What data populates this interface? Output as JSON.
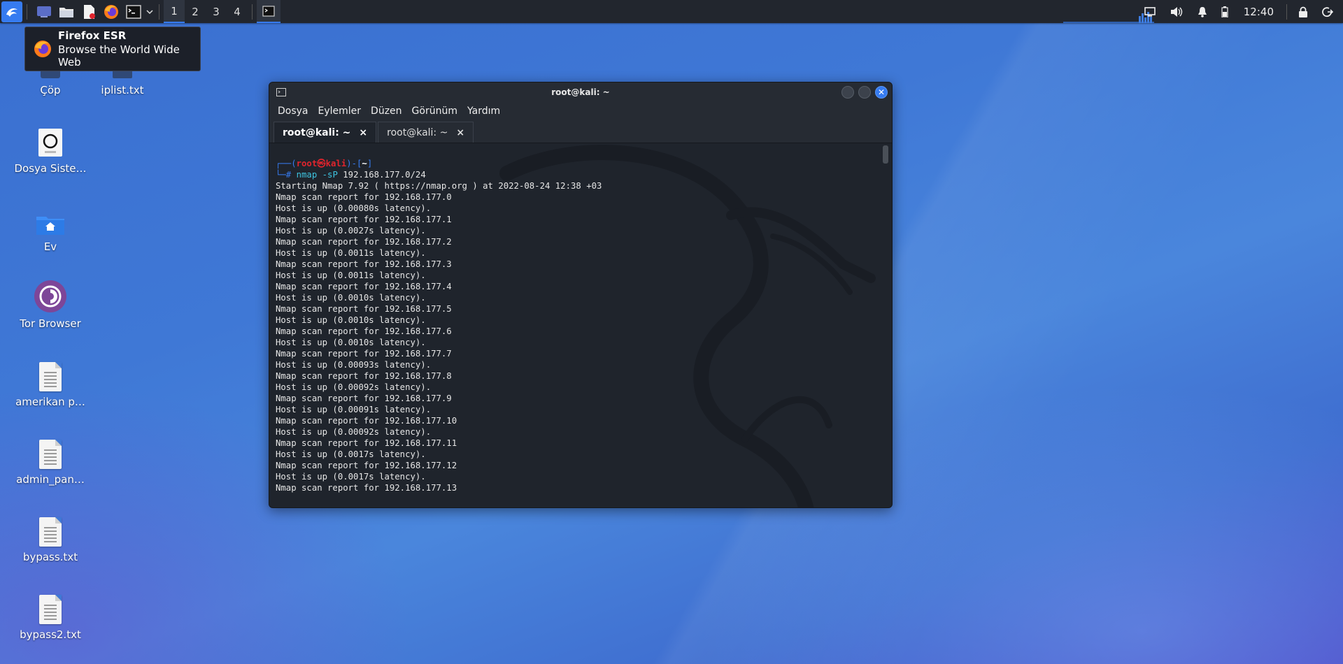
{
  "panel": {
    "workspaces": [
      "1",
      "2",
      "3",
      "4"
    ],
    "active_workspace": "1",
    "clock": "12:40"
  },
  "tooltip": {
    "title": "Firefox ESR",
    "subtitle": "Browse the World Wide Web"
  },
  "desktop": {
    "icons": [
      {
        "label": "Çöp",
        "icon": "trash-icon"
      },
      {
        "label": "iplist.txt",
        "icon": "text-file-icon"
      },
      {
        "label": "Dosya Siste…",
        "icon": "drive-icon"
      },
      {
        "label": "Ev",
        "icon": "home-folder-icon"
      },
      {
        "label": "Tor Browser",
        "icon": "tor-browser-icon"
      },
      {
        "label": "amerikan p…",
        "icon": "text-file-icon"
      },
      {
        "label": "admin_pan…",
        "icon": "text-file-icon"
      },
      {
        "label": "bypass.txt",
        "icon": "text-file-icon"
      },
      {
        "label": "bypass2.txt",
        "icon": "text-file-icon"
      }
    ]
  },
  "terminal": {
    "title": "root@kali: ~",
    "menu": [
      "Dosya",
      "Eylemler",
      "Düzen",
      "Görünüm",
      "Yardım"
    ],
    "tabs": [
      {
        "label": "root@kali: ~",
        "close": "×"
      },
      {
        "label": "root@kali: ~",
        "close": "×"
      }
    ],
    "prompt": {
      "open": "┌──(",
      "user": "root",
      "at": "㉿",
      "host": "kali",
      "mid": ")-[",
      "path": "~",
      "close": "]",
      "hash": "└─#",
      "command": "nmap -sP",
      "args": "192.168.177.0/24"
    },
    "output": [
      "Starting Nmap 7.92 ( https://nmap.org ) at 2022-08-24 12:38 +03",
      "Nmap scan report for 192.168.177.0",
      "Host is up (0.00080s latency).",
      "Nmap scan report for 192.168.177.1",
      "Host is up (0.0027s latency).",
      "Nmap scan report for 192.168.177.2",
      "Host is up (0.0011s latency).",
      "Nmap scan report for 192.168.177.3",
      "Host is up (0.0011s latency).",
      "Nmap scan report for 192.168.177.4",
      "Host is up (0.0010s latency).",
      "Nmap scan report for 192.168.177.5",
      "Host is up (0.0010s latency).",
      "Nmap scan report for 192.168.177.6",
      "Host is up (0.0010s latency).",
      "Nmap scan report for 192.168.177.7",
      "Host is up (0.00093s latency).",
      "Nmap scan report for 192.168.177.8",
      "Host is up (0.00092s latency).",
      "Nmap scan report for 192.168.177.9",
      "Host is up (0.00091s latency).",
      "Nmap scan report for 192.168.177.10",
      "Host is up (0.00092s latency).",
      "Nmap scan report for 192.168.177.11",
      "Host is up (0.0017s latency).",
      "Nmap scan report for 192.168.177.12",
      "Host is up (0.0017s latency).",
      "Nmap scan report for 192.168.177.13"
    ]
  },
  "colors": {
    "accent": "#367bf0",
    "panel": "#22262e",
    "terminal_bg": "#1f242c",
    "prompt_red": "#e0242d"
  }
}
